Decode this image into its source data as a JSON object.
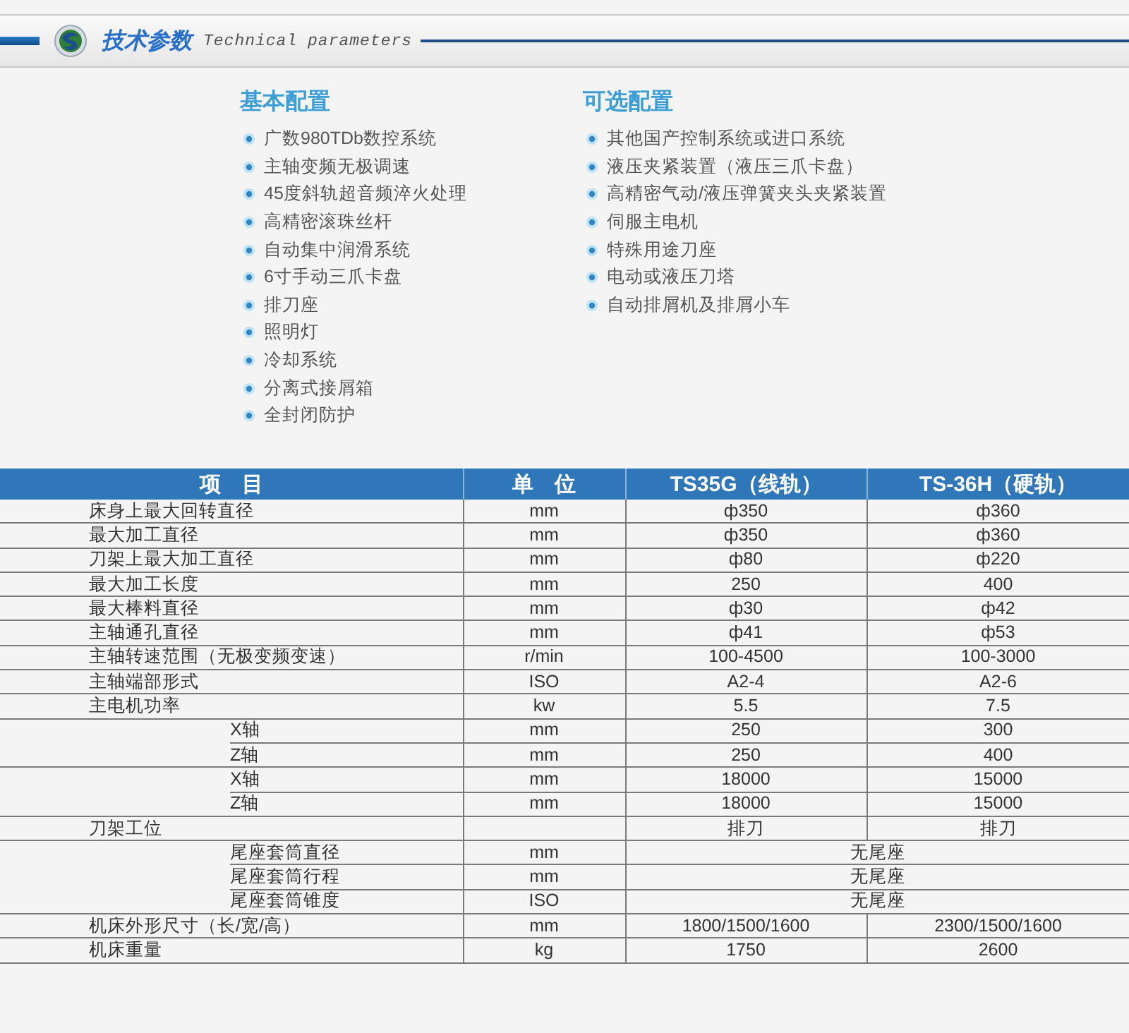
{
  "header": {
    "title": "技术参数",
    "subtitle": "Technical parameters"
  },
  "configs": [
    {
      "title": "基本配置",
      "items": [
        "广数980TDb数控系统",
        "主轴变频无极调速",
        "45度斜轨超音频淬火处理",
        "高精密滚珠丝杆",
        "自动集中润滑系统",
        "6寸手动三爪卡盘",
        "排刀座",
        "照明灯",
        "冷却系统",
        "分离式接屑箱",
        "全封闭防护"
      ]
    },
    {
      "title": "可选配置",
      "items": [
        "其他国产控制系统或进口系统",
        "液压夹紧装置（液压三爪卡盘）",
        "高精密气动/液压弹簧夹头夹紧装置",
        "伺服主电机",
        "特殊用途刀座",
        "电动或液压刀塔",
        "自动排屑机及排屑小车"
      ]
    }
  ],
  "table": {
    "columns": [
      "项　目",
      "单　位",
      "TS35G（线轨）",
      "TS-36H（硬轨）"
    ],
    "rows": [
      {
        "kind": "main",
        "label": "床身上最大回转直径",
        "unit": "mm",
        "values": [
          "ф350",
          "ф360"
        ]
      },
      {
        "kind": "main",
        "label": "最大加工直径",
        "unit": "mm",
        "values": [
          "ф350",
          "ф360"
        ]
      },
      {
        "kind": "main",
        "label": "刀架上最大加工直径",
        "unit": "mm",
        "values": [
          "ф80",
          "ф220"
        ]
      },
      {
        "kind": "main",
        "label": "最大加工长度",
        "unit": "mm",
        "values": [
          "250",
          "400"
        ]
      },
      {
        "kind": "main",
        "label": "最大棒料直径",
        "unit": "mm",
        "values": [
          "ф30",
          "ф42"
        ]
      },
      {
        "kind": "main",
        "label": "主轴通孔直径",
        "unit": "mm",
        "values": [
          "ф41",
          "ф53"
        ]
      },
      {
        "kind": "main",
        "label": "主轴转速范围（无极变频变速）",
        "unit": "r/min",
        "values": [
          "100-4500",
          "100-3000"
        ]
      },
      {
        "kind": "main",
        "label": "主轴端部形式",
        "unit": "ISO",
        "values": [
          "A2-4",
          "A2-6"
        ]
      },
      {
        "kind": "main",
        "label": "主电机功率",
        "unit": "kw",
        "values": [
          "5.5",
          "7.5"
        ]
      },
      {
        "kind": "group",
        "children": [
          {
            "label": "X轴",
            "unit": "mm",
            "values": [
              "250",
              "300"
            ]
          },
          {
            "label": "Z轴",
            "unit": "mm",
            "values": [
              "250",
              "400"
            ]
          }
        ]
      },
      {
        "kind": "group",
        "children": [
          {
            "label": "X轴",
            "unit": "mm",
            "values": [
              "18000",
              "15000"
            ]
          },
          {
            "label": "Z轴",
            "unit": "mm",
            "values": [
              "18000",
              "15000"
            ]
          }
        ]
      },
      {
        "kind": "main",
        "label": "刀架工位",
        "values": [
          "排刀",
          "排刀"
        ]
      },
      {
        "kind": "group",
        "children": [
          {
            "label": "尾座套筒直径",
            "unit": "mm",
            "values": [
              "无尾座"
            ]
          },
          {
            "label": "尾座套筒行程",
            "unit": "mm",
            "values": [
              "无尾座"
            ]
          },
          {
            "label": "尾座套筒锥度",
            "unit": "ISO",
            "values": [
              "无尾座"
            ]
          }
        ]
      },
      {
        "kind": "main",
        "label": "机床外形尺寸（长/宽/高）",
        "unit": "mm",
        "values": [
          "1800/1500/1600",
          "2300/1500/1600"
        ]
      },
      {
        "kind": "main",
        "label": "机床重量",
        "unit": "kg",
        "values": [
          "1750",
          "2600"
        ]
      }
    ]
  }
}
